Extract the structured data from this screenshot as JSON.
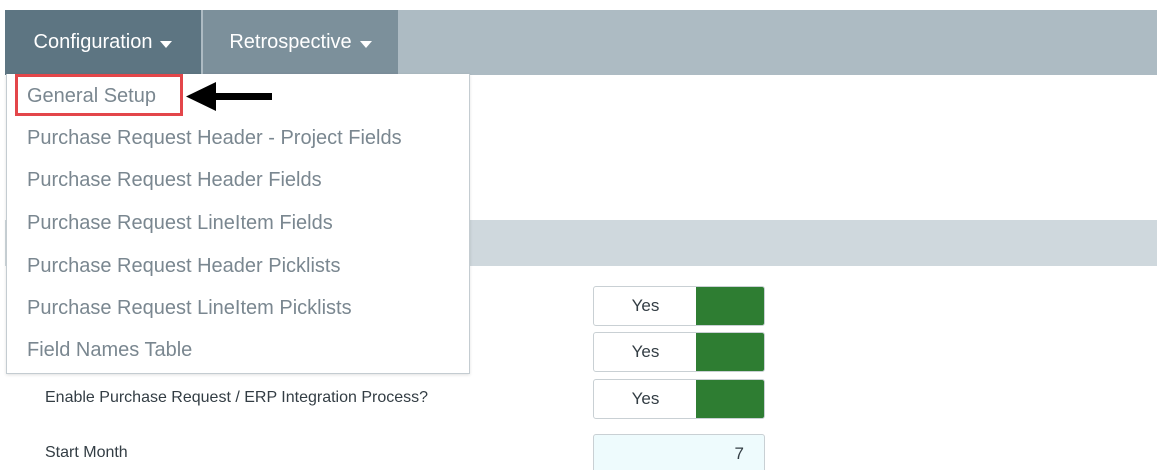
{
  "navbar": {
    "tabs": [
      {
        "label": "Configuration"
      },
      {
        "label": "Retrospective"
      }
    ]
  },
  "dropdown": {
    "items": [
      {
        "label": "General Setup",
        "highlighted": true
      },
      {
        "label": "Purchase Request Header - Project Fields"
      },
      {
        "label": "Purchase Request Header Fields"
      },
      {
        "label": "Purchase Request LineItem Fields"
      },
      {
        "label": "Purchase Request Header Picklists"
      },
      {
        "label": "Purchase Request LineItem Picklists"
      },
      {
        "label": "Field Names Table"
      }
    ]
  },
  "form": {
    "toggles": [
      {
        "value": "Yes"
      },
      {
        "value": "Yes"
      },
      {
        "label": "Enable Purchase Request / ERP Integration Process?",
        "value": "Yes"
      }
    ],
    "start_month": {
      "label": "Start Month",
      "value": "7"
    }
  },
  "colors": {
    "nav_active": "#5d7582",
    "nav_secondary": "#7c909b",
    "navbar_bg": "#adbbc3",
    "toggle_on": "#2e7d32",
    "highlight": "#e3464a"
  }
}
